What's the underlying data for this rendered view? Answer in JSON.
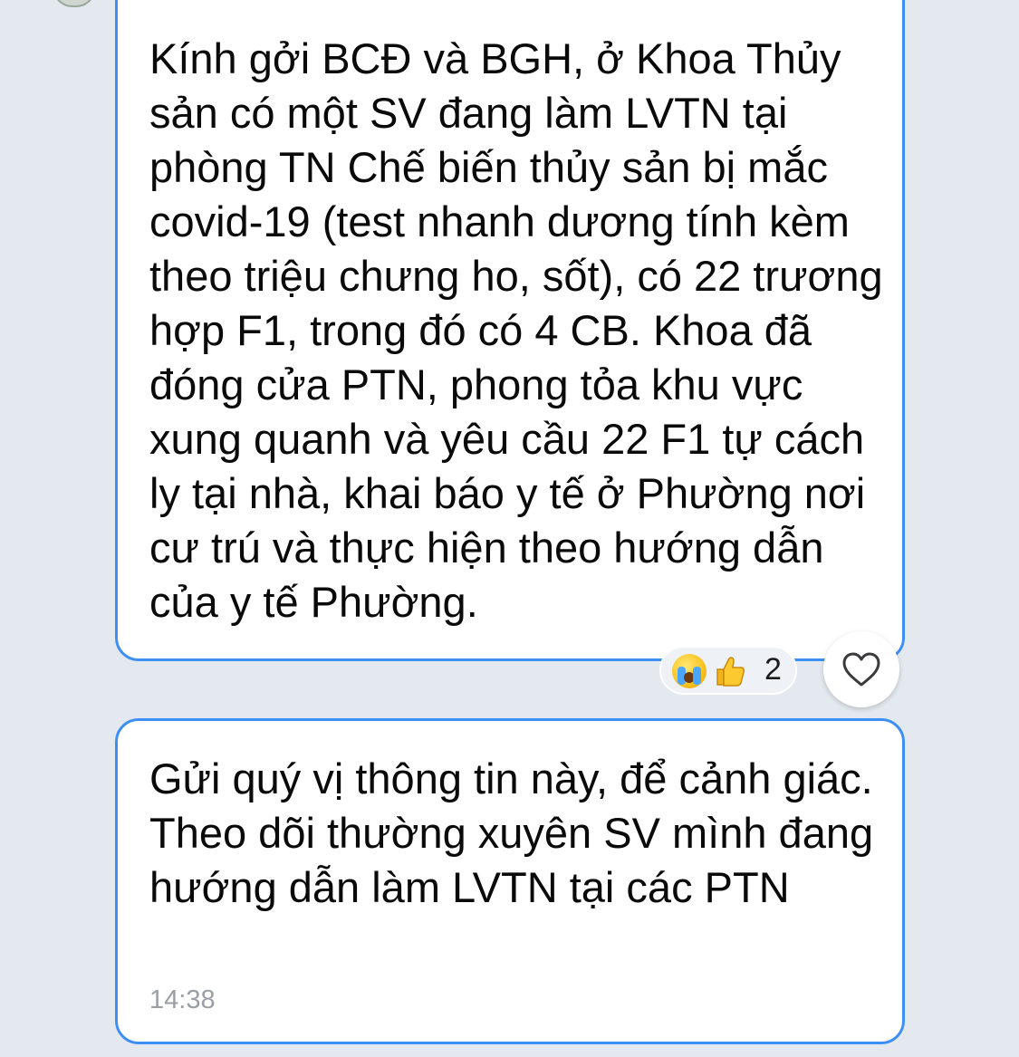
{
  "messages": [
    {
      "text": "Kính gởi BCĐ và BGH, ở Khoa Thủy sản có một SV đang làm LVTN tại phòng TN Chế biến thủy sản bị mắc covid-19 (test nhanh dương tính kèm theo triệu chưng ho, sốt), có 22 trương hợp F1, trong đó có 4 CB. Khoa đã đóng cửa PTN, phong tỏa khu vực xung quanh và yêu cầu 22 F1 tự cách ly tại nhà, khai báo y tế ở Phường nơi cư trú và thực hiện theo hướng dẫn của y tế Phường.",
      "reactions": {
        "icons": [
          "crying-face-icon",
          "thumbs-up-icon"
        ],
        "count": "2"
      }
    },
    {
      "text": "Gửi quý vị thông tin này, để cảnh giác. Theo dõi thường xuyên SV mình đang hướng dẫn làm LVTN tại các PTN",
      "time": "14:38"
    }
  ],
  "heart_button": {
    "icon": "heart-outline-icon"
  },
  "colors": {
    "background": "#e4e9f0",
    "bubble_border": "#3d8ff5",
    "bubble_fill": "#ffffff",
    "timestamp": "#9a9fa6"
  }
}
